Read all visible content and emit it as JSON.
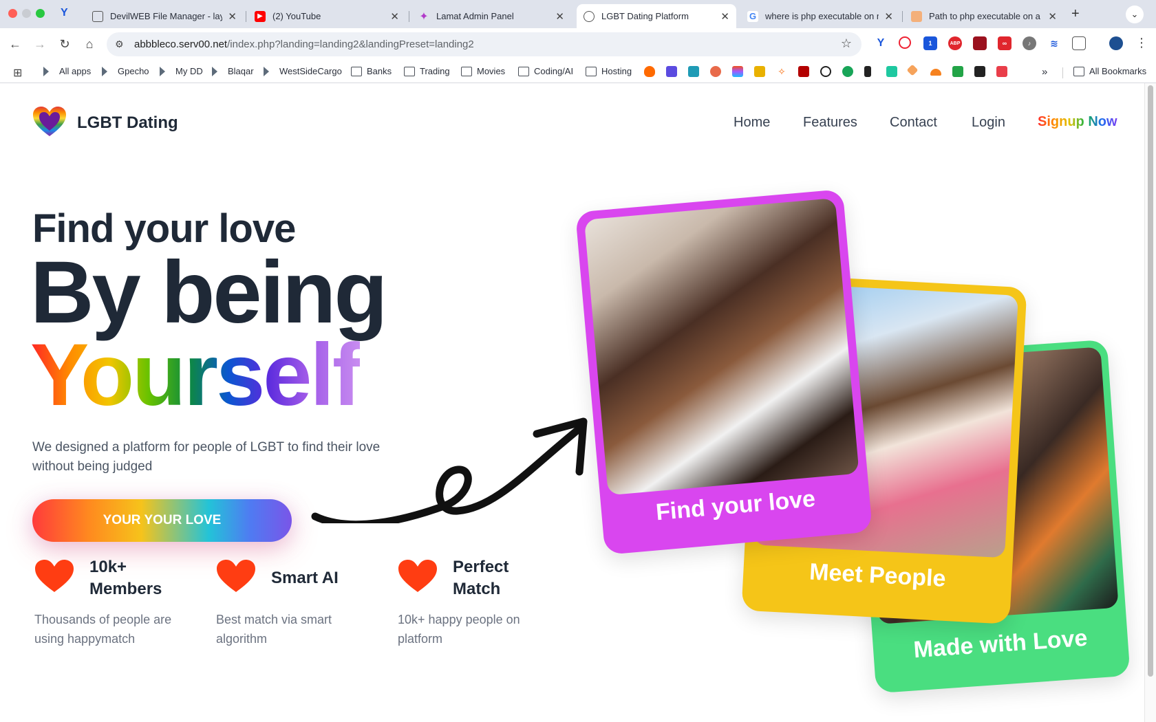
{
  "browser": {
    "tabs": [
      {
        "title": "DevilWEB File Manager - layo"
      },
      {
        "title": "(2) YouTube"
      },
      {
        "title": "Lamat Admin Panel"
      },
      {
        "title": "LGBT Dating Platform"
      },
      {
        "title": "where is php executable on m"
      },
      {
        "title": "Path to php executable on a m"
      }
    ],
    "url_host": "abbbleco.serv00.net",
    "url_path": "/index.php?landing=landing2&landingPreset=landing2",
    "bookmarks": [
      "All apps",
      "Gpecho",
      "My DD",
      "Blaqar",
      "WestSideCargo",
      "Banks",
      "Trading",
      "Movies",
      "Coding/AI",
      "Hosting"
    ],
    "all_bookmarks": "All Bookmarks",
    "overflow": "»",
    "ext_badge": "1",
    "ext_abp": "ABP"
  },
  "site": {
    "brand": "LGBT Dating",
    "nav": [
      "Home",
      "Features",
      "Contact",
      "Login"
    ],
    "signup": "Signup Now",
    "headline_1": "Find your love",
    "headline_2": "By being",
    "headline_3": "Yourself",
    "description": "We designed a platform for people of LGBT to find their love without being judged",
    "cta": "YOUR YOUR LOVE",
    "features": [
      {
        "title": "10k+ Members",
        "desc": "Thousands of people are using happymatch"
      },
      {
        "title": "Smart AI",
        "desc": "Best match via smart algorithm"
      },
      {
        "title": "Perfect Match",
        "desc": "10k+ happy people on platform"
      }
    ],
    "cards": [
      {
        "caption": "Find your love",
        "color": "#d946ef"
      },
      {
        "caption": "Meet People",
        "color": "#f5c518"
      },
      {
        "caption": "Made with Love",
        "color": "#4ade80"
      }
    ],
    "heart_color": "#ff3d12"
  }
}
